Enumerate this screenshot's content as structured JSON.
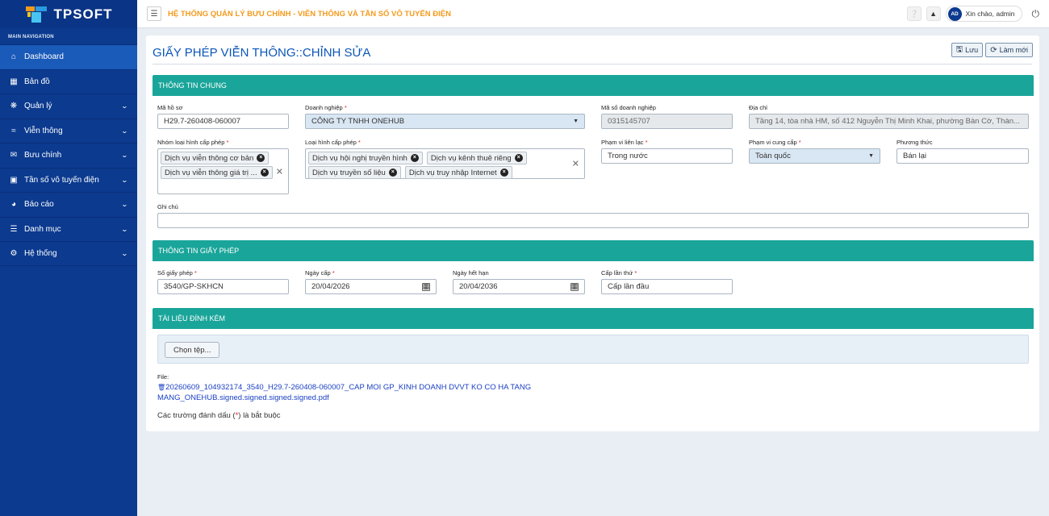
{
  "app": {
    "logo_text": "TPSOFT",
    "system_title": "HỆ THỐNG QUẢN LÝ BƯU CHÍNH - VIỄN THÔNG VÀ TẦN SỐ VÔ TUYẾN ĐIỆN"
  },
  "topbar": {
    "user_initials": "AD",
    "greeting": "Xin chào, admin"
  },
  "sidebar": {
    "header": "MAIN NAVIGATION",
    "items": [
      {
        "label": "Dashboard",
        "icon": "home-icon",
        "active": true
      },
      {
        "label": "Bản đồ",
        "icon": "map-icon"
      },
      {
        "label": "Quản lý",
        "icon": "gears-icon"
      },
      {
        "label": "Viễn thông",
        "icon": "wifi-icon"
      },
      {
        "label": "Bưu chính",
        "icon": "envelope-icon"
      },
      {
        "label": "Tần số vô tuyến điện",
        "icon": "id-card-icon"
      },
      {
        "label": "Báo cáo",
        "icon": "pie-chart-icon"
      },
      {
        "label": "Danh mục",
        "icon": "list-icon"
      },
      {
        "label": "Hệ thống",
        "icon": "cog-icon"
      }
    ]
  },
  "page": {
    "title": "GIẤY PHÉP VIỄN THÔNG::CHỈNH SỬA",
    "save_label": "Lưu",
    "refresh_label": "Làm mới"
  },
  "general": {
    "section_title": "THÔNG TIN CHUNG",
    "ma_ho_so_label": "Mã hồ sơ",
    "ma_ho_so_value": "H29.7-260408-060007",
    "doanh_nghiep_label": "Doanh nghiệp",
    "doanh_nghiep_value": "CÔNG TY TNHH ONEHUB",
    "ma_so_dn_label": "Mã số doanh nghiệp",
    "ma_so_dn_value": "0315145707",
    "dia_chi_label": "Địa chỉ",
    "dia_chi_value": "Tầng 14, tòa nhà HM, số 412 Nguyễn Thị Minh Khai, phường Bàn Cờ, Thàn...",
    "nhom_loai_hinh_label": "Nhóm loại hình cấp phép",
    "nhom_loai_hinh_tags": [
      "Dịch vụ viễn thông cơ bản",
      "Dịch vụ viễn thông giá trị ..."
    ],
    "loai_hinh_label": "Loại hình cấp phép",
    "loai_hinh_tags": [
      "Dịch vụ hội nghị truyền hình",
      "Dịch vụ kênh thuê riêng",
      "Dịch vụ truyền số liệu",
      "Dịch vụ truy nhập Internet"
    ],
    "pham_vi_lien_lac_label": "Phạm vi liên lạc",
    "pham_vi_lien_lac_value": "Trong nước",
    "pham_vi_cung_cap_label": "Phạm vi cung cấp",
    "pham_vi_cung_cap_value": "Toàn quốc",
    "phuong_thuc_label": "Phương thức",
    "phuong_thuc_value": "Bán lại",
    "ghi_chu_label": "Ghi chú",
    "ghi_chu_value": ""
  },
  "license": {
    "section_title": "THÔNG TIN GIẤY PHÉP",
    "so_gp_label": "Số giấy phép",
    "so_gp_value": "3540/GP-SKHCN",
    "ngay_cap_label": "Ngày cấp",
    "ngay_cap_value": "20/04/2026",
    "ngay_het_han_label": "Ngày hết hạn",
    "ngay_het_han_value": "20/04/2036",
    "cap_lan_thu_label": "Cấp lần thứ",
    "cap_lan_thu_value": "Cấp lần đầu"
  },
  "attachments": {
    "section_title": "TÀI LIỆU ĐÍNH KÈM",
    "choose_label": "Chọn tệp...",
    "file_label": "File:",
    "file_name": "20260609_104932174_3540_H29.7-260408-060007_CAP MOI GP_KINH DOANH DVVT KO CO HA TANG MANG_ONEHUB.signed.signed.signed.signed.pdf",
    "note_prefix": "Các trường đánh dấu (",
    "note_star": "*",
    "note_suffix": ") là bắt buộc"
  }
}
